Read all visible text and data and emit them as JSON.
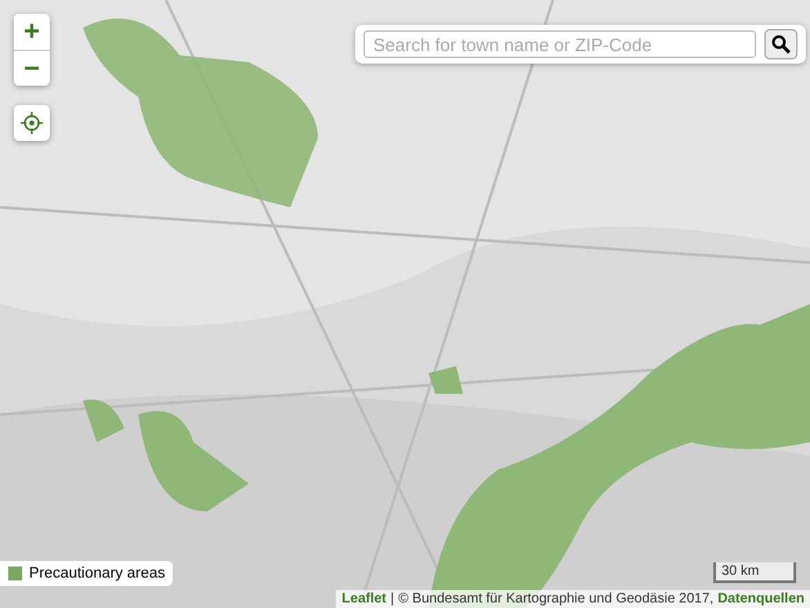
{
  "zoom_controls": [
    {
      "label": "+"
    },
    {
      "label": "−"
    }
  ],
  "search": {
    "placeholder": "Search for town name or ZIP-Code"
  },
  "legend": {
    "items": [
      {
        "label": "Precautionary areas",
        "color": "#7aa862"
      }
    ]
  },
  "scale": {
    "label": "30 km"
  },
  "attribution": {
    "link": "Leaflet",
    "separator": "|",
    "text": "© Bundesamt für Kartographie und Geodäsie 2017,",
    "source_link": "Datenquellen"
  }
}
